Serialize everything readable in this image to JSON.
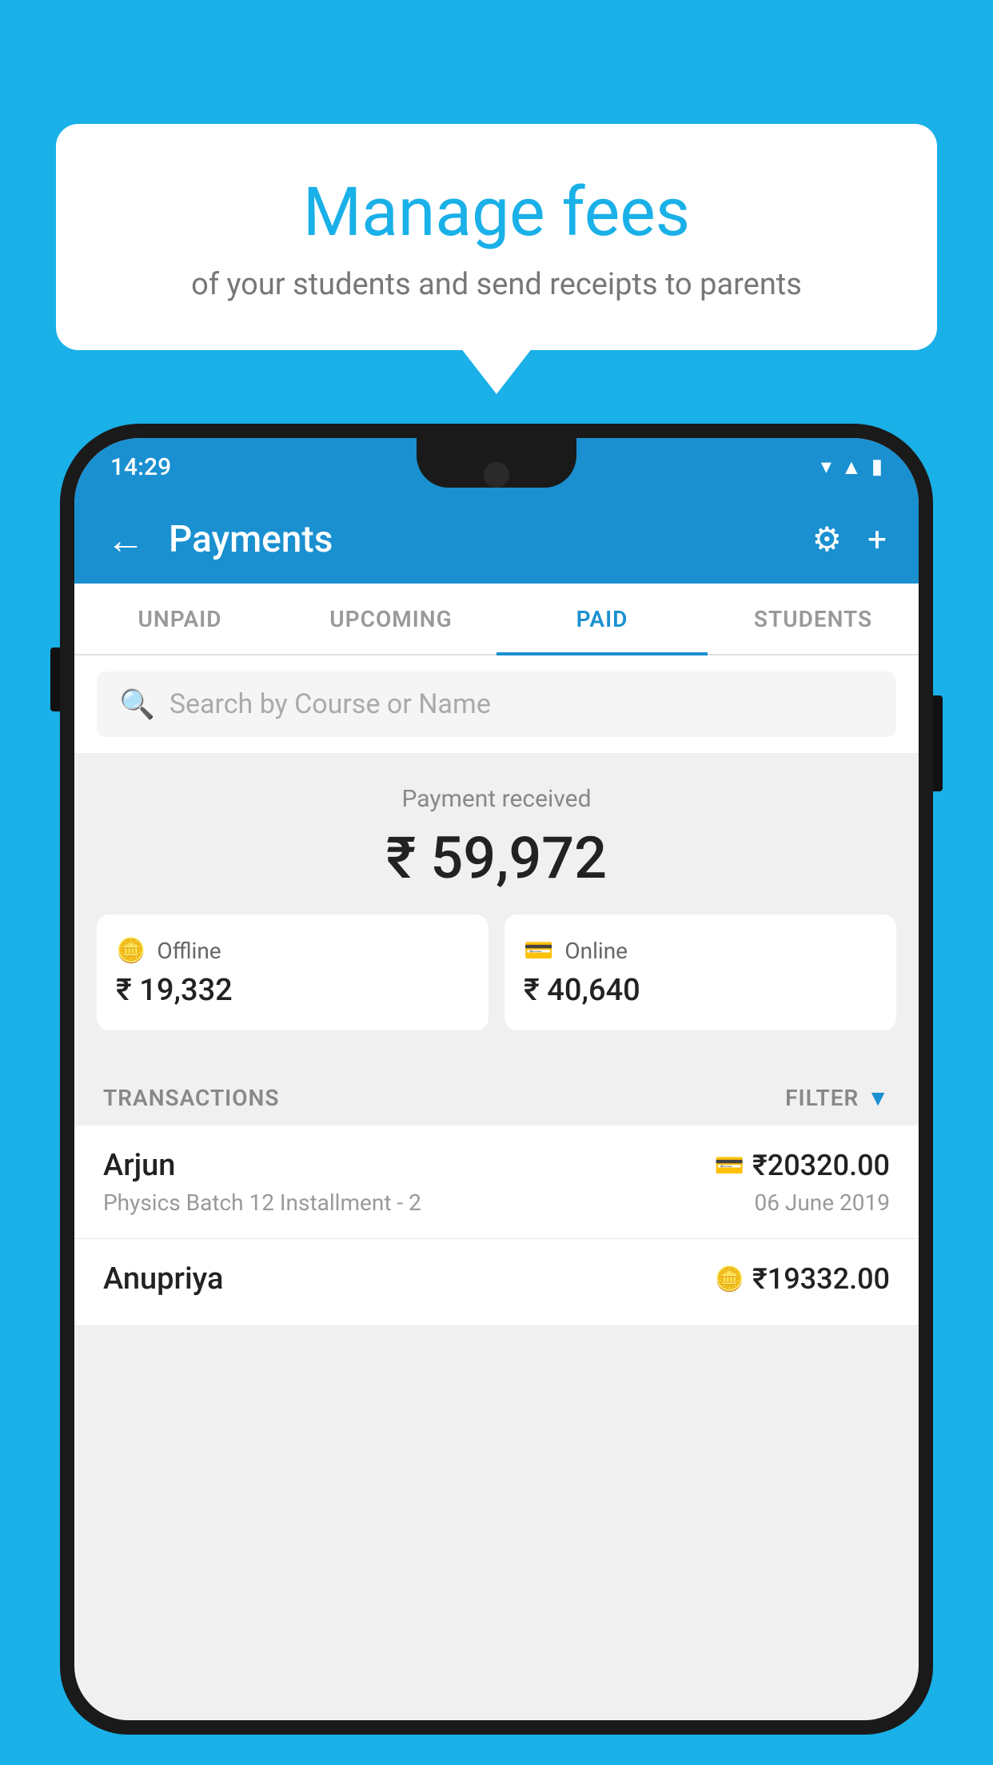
{
  "background_color": "#1ab0e8",
  "speech_bubble": {
    "title": "Manage fees",
    "subtitle": "of your students and send receipts to parents"
  },
  "status_bar": {
    "time": "14:29",
    "icons": [
      "wifi",
      "signal",
      "battery"
    ]
  },
  "app_bar": {
    "title": "Payments",
    "back_label": "←",
    "settings_label": "⚙",
    "add_label": "+"
  },
  "tabs": [
    {
      "label": "UNPAID",
      "active": false
    },
    {
      "label": "UPCOMING",
      "active": false
    },
    {
      "label": "PAID",
      "active": true
    },
    {
      "label": "STUDENTS",
      "active": false
    }
  ],
  "search": {
    "placeholder": "Search by Course or Name"
  },
  "payment_summary": {
    "label": "Payment received",
    "total": "₹ 59,972",
    "offline_label": "Offline",
    "offline_amount": "₹ 19,332",
    "online_label": "Online",
    "online_amount": "₹ 40,640"
  },
  "transactions": {
    "section_label": "TRANSACTIONS",
    "filter_label": "FILTER",
    "rows": [
      {
        "name": "Arjun",
        "detail": "Physics Batch 12 Installment - 2",
        "amount": "₹20320.00",
        "date": "06 June 2019",
        "pay_type": "online"
      },
      {
        "name": "Anupriya",
        "detail": "",
        "amount": "₹19332.00",
        "date": "",
        "pay_type": "offline"
      }
    ]
  }
}
